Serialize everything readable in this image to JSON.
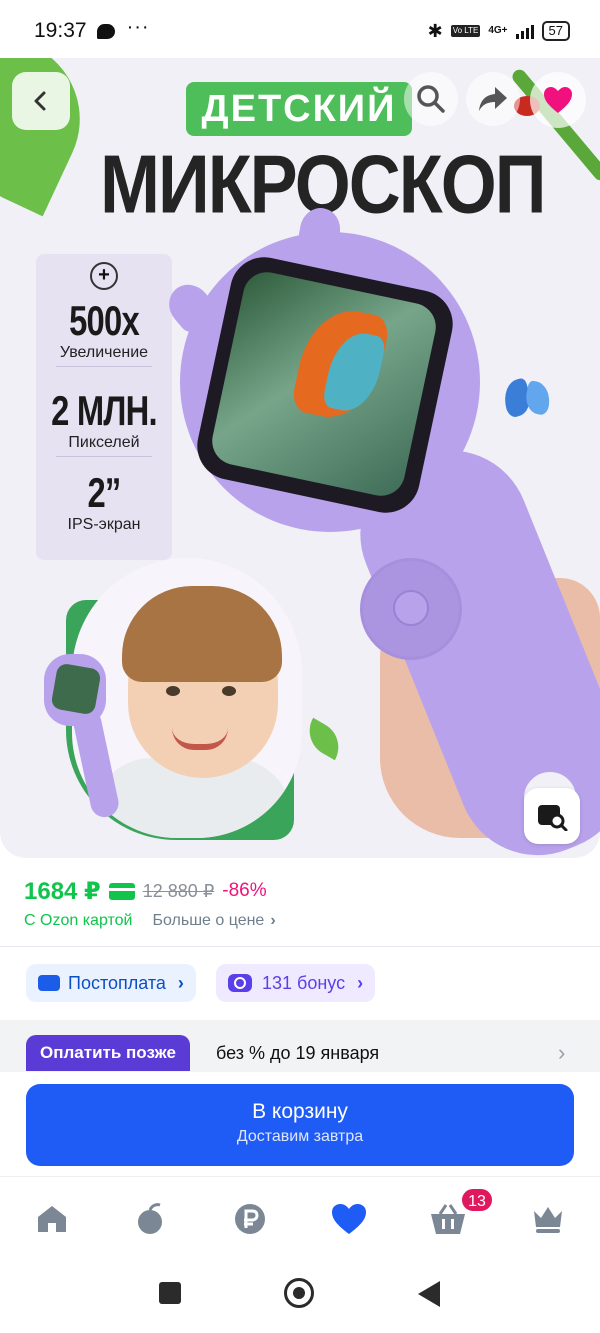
{
  "status_bar": {
    "time": "19:37",
    "dots": "···",
    "bluetooth": "✱",
    "volte": "Vo LTE",
    "network": "4G+",
    "battery": "57"
  },
  "hero": {
    "badge_title": "ДЕТСКИЙ",
    "main_title": "МИКРОСКОП",
    "specs": [
      {
        "value": "500x",
        "label": "Увеличение"
      },
      {
        "value": "2 МЛН.",
        "label": "Пикселей"
      },
      {
        "value": "2”",
        "label": "IPS-экран"
      }
    ],
    "icons": {
      "back": "chevron-left-icon",
      "search": "search-icon",
      "share": "share-icon",
      "favorite": "heart-icon",
      "image_search": "image-search-icon"
    }
  },
  "price": {
    "current": "1684 ₽",
    "old": "12 880 ₽",
    "discount": "-86%",
    "ozon_card": "С Ozon картой",
    "more": "Больше о цене",
    "colors": {
      "green": "#10c44c",
      "pink": "#f1117e"
    }
  },
  "offers": {
    "postpay": "Постоплата",
    "bonus": "131 бонус"
  },
  "pay_later": {
    "badge": "Оплатить позже",
    "text": "без % до 19 января"
  },
  "cart_button": {
    "title": "В корзину",
    "subtitle": "Доставим завтра",
    "color": "#1f5cf5"
  },
  "bottom_nav": {
    "items": [
      "home-icon",
      "fresh-icon",
      "ruble-icon",
      "favorites-icon",
      "cart-icon",
      "crown-icon"
    ],
    "cart_badge": "13"
  }
}
